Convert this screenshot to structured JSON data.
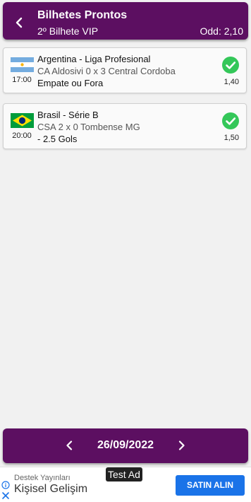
{
  "header": {
    "title": "Bilhetes Prontos",
    "subtitle": "2º Bilhete VIP",
    "odd": "Odd: 2,10"
  },
  "bets": [
    {
      "flag": "argentina-flag-icon",
      "time": "17:00",
      "league": "Argentina - Liga Profesional",
      "match": "CA Aldosivi 0 x 3 Central Cordoba",
      "bet": "Empate ou Fora",
      "odd": "1,40",
      "status": "won"
    },
    {
      "flag": "brazil-flag-icon",
      "time": "20:00",
      "league": "Brasil - Série B",
      "match": "CSA 2 x 0 Tombense MG",
      "bet": "- 2.5 Gols",
      "odd": "1,50",
      "status": "won"
    }
  ],
  "footer": {
    "date": "26/09/2022"
  },
  "ad": {
    "badge": "Test Ad",
    "advertiser": "Destek Yayınları",
    "headline": "Kişisel Gelişim",
    "cta": "SATIN ALIN"
  },
  "colors": {
    "primary": "#5c0f61",
    "success": "#34c759",
    "cta": "#1a73e8"
  }
}
